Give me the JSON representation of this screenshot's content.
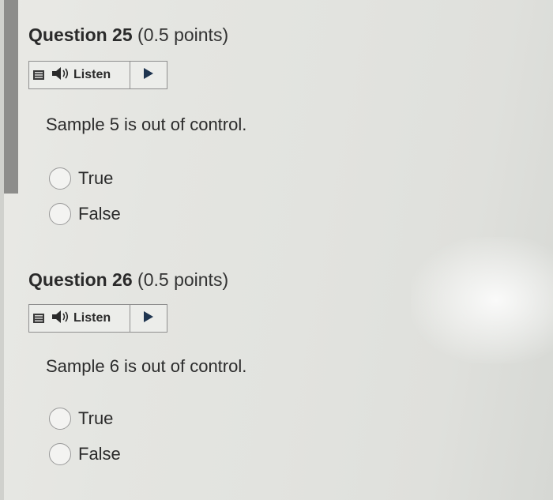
{
  "questions": [
    {
      "number_label": "Question 25",
      "points_label": "(0.5 points)",
      "listen_label": "Listen",
      "prompt": "Sample 5 is out of control.",
      "options": [
        "True",
        "False"
      ]
    },
    {
      "number_label": "Question 26",
      "points_label": "(0.5 points)",
      "listen_label": "Listen",
      "prompt": "Sample 6 is out of control.",
      "options": [
        "True",
        "False"
      ]
    }
  ],
  "icons": {
    "menu": "menu-icon",
    "speaker": "speaker-icon",
    "play": "play-icon"
  },
  "colors": {
    "background": "#e4e5e1",
    "accent_bar": "#8d8d8b",
    "text": "#2b2b2b",
    "play_triangle": "#1f3550"
  }
}
